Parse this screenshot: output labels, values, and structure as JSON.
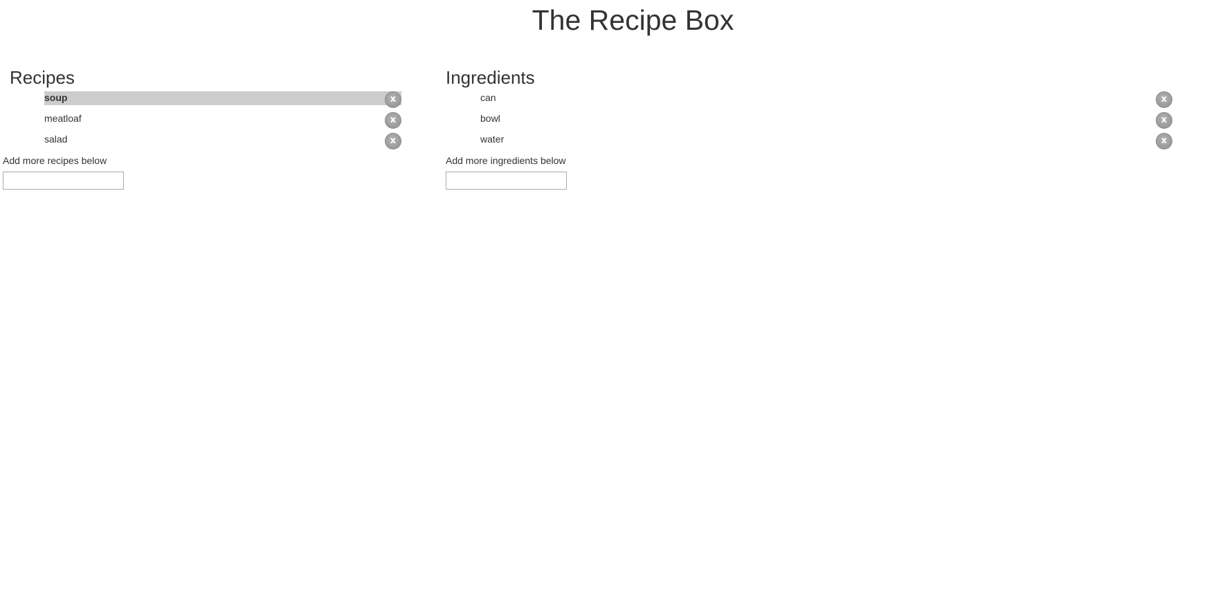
{
  "app": {
    "title": "The Recipe Box"
  },
  "recipes": {
    "heading": "Recipes",
    "items": [
      {
        "label": "soup",
        "remove_label": "x"
      },
      {
        "label": "meatloaf",
        "remove_label": "x"
      },
      {
        "label": "salad",
        "remove_label": "x"
      }
    ],
    "selected_label": "soup",
    "add_label": "Add more recipes below",
    "input_value": "",
    "input_placeholder": ""
  },
  "ingredients": {
    "heading": "Ingredients",
    "items": [
      {
        "label": "can",
        "remove_label": "x"
      },
      {
        "label": "bowl",
        "remove_label": "x"
      },
      {
        "label": "water",
        "remove_label": "x"
      }
    ],
    "add_label": "Add more ingredients below",
    "input_value": "",
    "input_placeholder": ""
  },
  "colors": {
    "text": "#333333",
    "selected_background": "#cccccc",
    "remove_button": "#9a9a9a"
  }
}
